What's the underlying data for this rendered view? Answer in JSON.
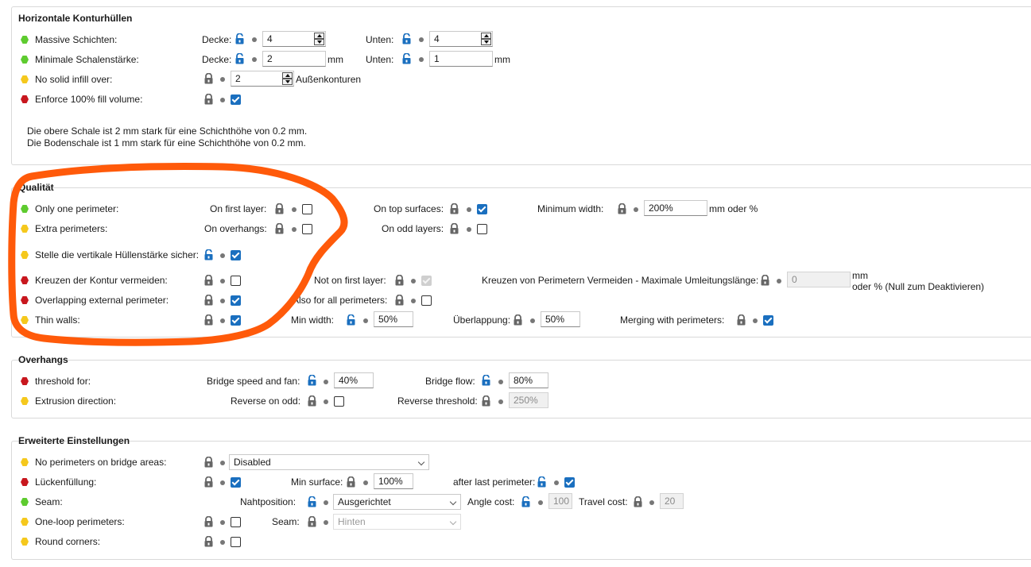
{
  "colors": {
    "green": "#5ecb2f",
    "yellow": "#f5c81d",
    "red": "#c8171e",
    "lock_open": "#1a6fbf",
    "lock_closed": "#666666",
    "annotation": "#ff5a0a"
  },
  "horizontal": {
    "title": "Horizontale Konturhüllen",
    "solid_layers": {
      "label": "Massive Schichten:",
      "top_label": "Decke:",
      "top_value": "4",
      "bottom_label": "Unten:",
      "bottom_value": "4"
    },
    "min_shell": {
      "label": "Minimale Schalenstärke:",
      "top_label": "Decke:",
      "top_value": "2",
      "top_unit": "mm",
      "bottom_label": "Unten:",
      "bottom_value": "1",
      "bottom_unit": "mm"
    },
    "no_solid_infill": {
      "label": "No solid infill over:",
      "value": "2",
      "unit": "Außenkonturen"
    },
    "enforce_fill": {
      "label": "Enforce 100% fill volume:"
    },
    "info_line1": "Die obere Schale ist 2 mm stark für eine Schichthöhe von 0.2 mm.",
    "info_line2": "Die Bodenschale ist 1 mm stark für eine Schichthöhe von 0.2 mm."
  },
  "quality": {
    "title": "Qualität",
    "only_one_perimeter": {
      "label": "Only one perimeter:",
      "first_layer_label": "On first layer:",
      "top_surfaces_label": "On top surfaces:",
      "min_width_label": "Minimum width:",
      "min_width_value": "200%",
      "min_width_unit": "mm oder %"
    },
    "extra_perimeters": {
      "label": "Extra perimeters:",
      "overhangs_label": "On overhangs:",
      "odd_layers_label": "On odd layers:"
    },
    "vertical_shell": {
      "label": "Stelle die vertikale Hüllenstärke sicher:"
    },
    "avoid_crossing": {
      "label": "Kreuzen der Kontur vermeiden:",
      "not_first_label": "Not on first layer:",
      "max_detour_label": "Kreuzen von Perimetern Vermeiden - Maximale Umleitungslänge:",
      "max_detour_value": "0",
      "unit_line1": "mm",
      "unit_line2": "oder % (Null zum Deaktivieren)"
    },
    "overlapping": {
      "label": "Overlapping external perimeter:",
      "all_perimeters_label": "Also for all perimeters:"
    },
    "thin_walls": {
      "label": "Thin walls:",
      "min_width_label": "Min width:",
      "min_width_value": "50%",
      "overlap_label": "Überlappung:",
      "overlap_value": "50%",
      "merging_label": "Merging with perimeters:"
    }
  },
  "overhangs": {
    "title": "Overhangs",
    "threshold": {
      "label": "threshold for:",
      "bridge_speed_label": "Bridge speed and fan:",
      "bridge_speed_value": "40%",
      "bridge_flow_label": "Bridge flow:",
      "bridge_flow_value": "80%"
    },
    "extrusion_direction": {
      "label": "Extrusion direction:",
      "reverse_odd_label": "Reverse on odd:",
      "reverse_threshold_label": "Reverse threshold:",
      "reverse_threshold_value": "250%"
    }
  },
  "advanced": {
    "title": "Erweiterte Einstellungen",
    "no_perimeters_bridge": {
      "label": "No perimeters on bridge areas:",
      "selected": "Disabled"
    },
    "gap_fill": {
      "label": "Lückenfüllung:",
      "min_surface_label": "Min surface:",
      "min_surface_value": "100%",
      "after_last_label": "after last perimeter:"
    },
    "seam": {
      "label": "Seam:",
      "position_label": "Nahtposition:",
      "position_selected": "Ausgerichtet",
      "angle_cost_label": "Angle cost:",
      "angle_cost_value": "100",
      "travel_cost_label": "Travel cost:",
      "travel_cost_value": "20"
    },
    "one_loop": {
      "label": "One-loop perimeters:",
      "seam_label": "Seam:",
      "seam_selected": "Hinten"
    },
    "round_corners": {
      "label": "Round corners:"
    }
  }
}
